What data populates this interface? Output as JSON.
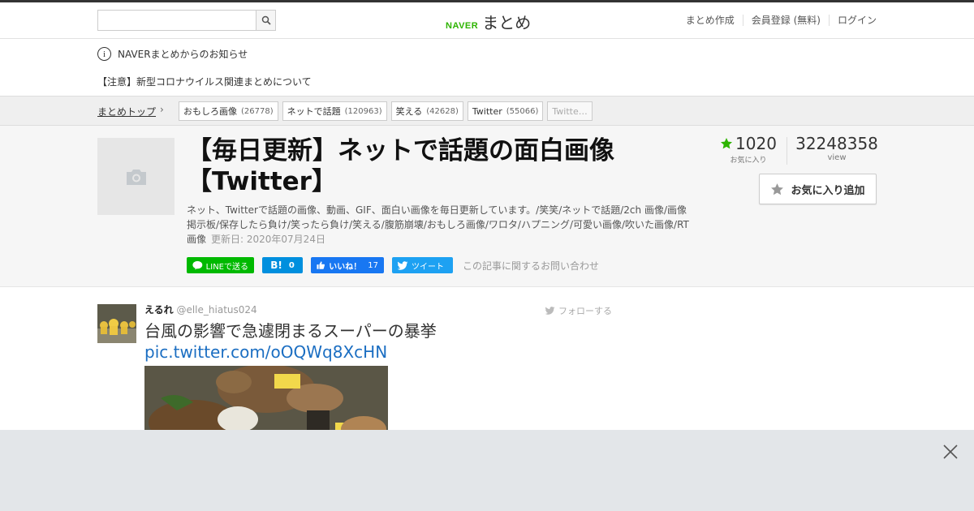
{
  "header": {
    "search_placeholder": "",
    "logo_brand": "NAVER",
    "logo_name": "まとめ",
    "links": [
      "まとめ作成",
      "会員登録 (無料)",
      "ログイン"
    ]
  },
  "notice": {
    "title": "NAVERまとめからのお知らせ",
    "link": "【注意】新型コロナウイルス関連まとめについて"
  },
  "breadcrumb": {
    "top": "まとめトップ",
    "tags": [
      {
        "label": "おもしろ画像",
        "count": "(26778)"
      },
      {
        "label": "ネットで話題",
        "count": "(120963)"
      },
      {
        "label": "笑える",
        "count": "(42628)"
      },
      {
        "label": "Twitter",
        "count": "(55066)"
      },
      {
        "label": "Twitte…",
        "count": ""
      }
    ]
  },
  "article": {
    "title": "【毎日更新】ネットで話題の面白画像【Twitter】",
    "description": "ネット、Twitterで話題の画像、動画、GIF、面白い画像を毎日更新しています。/笑笑/ネットで話題/2ch 画像/画像掲示板/保存したら負け/笑ったら負け/笑える/腹筋崩壊/おもしろ画像/ワロタ/ハプニング/可愛い画像/吹いた画像/RT画像",
    "updated": "更新日: 2020年07月24日",
    "favorites": "1020",
    "favorites_label": "お気に入り",
    "views": "32248358",
    "views_label": "view",
    "fav_add_label": "お気に入り追加",
    "share": {
      "line": "LINEで送る",
      "hatena_count": "0",
      "fb_label": "いいね！",
      "fb_count": "17",
      "tweet": "ツイート",
      "contact": "この記事に関するお問い合わせ"
    }
  },
  "tweet": {
    "name": "えるれ",
    "handle": "@elle_hiatus024",
    "follow": "フォローする",
    "text": "台風の影響で急遽閉まるスーパーの暴挙",
    "link": "pic.twitter.com/oOQWq8XcHN"
  },
  "colors": {
    "naver_green": "#2db400",
    "link_blue": "#1b6ec2",
    "line_green": "#00b900",
    "hatena_blue": "#008fde",
    "facebook_blue": "#1877f2",
    "twitter_blue": "#1da1f2"
  }
}
